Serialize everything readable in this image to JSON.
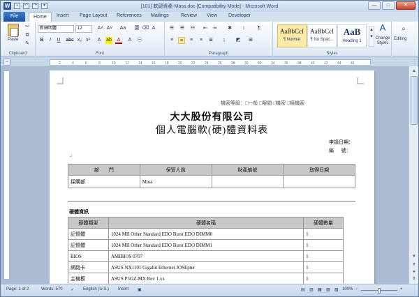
{
  "titlebar": {
    "title": "[101] 軟硬資產-Mass.doc [Compatibility Mode] - Microsoft Word",
    "logo": "W",
    "qat_icons": [
      "save-icon",
      "undo-icon",
      "redo-icon",
      "customize-icon"
    ],
    "controls": {
      "minimize": "—",
      "maximize": "□",
      "close": "✕"
    }
  },
  "tabs": {
    "file": "File",
    "items": [
      "Home",
      "Insert",
      "Page Layout",
      "References",
      "Mailings",
      "Review",
      "View",
      "Developer"
    ]
  },
  "ribbon": {
    "clipboard": {
      "label": "Clipboard",
      "paste": "Paste"
    },
    "font": {
      "label": "Font",
      "name": "新細明體",
      "size": "12",
      "bold": "B",
      "italic": "I",
      "underline": "U",
      "strike": "abc",
      "sub": "x₂",
      "sup": "x²",
      "grow": "A˄",
      "shrink": "A˅",
      "case": "Aa",
      "color": "A"
    },
    "paragraph": {
      "label": "Paragraph"
    },
    "styles": {
      "label": "Styles",
      "items": [
        {
          "sample": "AaBbCcI",
          "name": "¶ Normal"
        },
        {
          "sample": "AaBbCcI",
          "name": "¶ No Spac..."
        },
        {
          "sample": "AaB",
          "name": "Heading 1"
        }
      ],
      "change": "Change Styles"
    },
    "editing": {
      "label": "Editing"
    }
  },
  "ruler": {
    "ticks": [
      "2",
      "4",
      "6",
      "8",
      "10",
      "12",
      "14",
      "16",
      "18",
      "20",
      "22",
      "24",
      "26",
      "28",
      "30",
      "32",
      "34",
      "36",
      "38",
      "40",
      "42",
      "44",
      "46"
    ]
  },
  "document": {
    "classification": "機密等級：□一般  □限閱  □機密  □極機密",
    "company": "大大股份有限公司",
    "title": "個人電腦軟(硬)體資料表",
    "apply_date": "申請日期：",
    "number": "編      號：",
    "table1": {
      "headers": [
        "部　　門",
        "保管人員",
        "財產編號",
        "取得日期"
      ],
      "row": [
        "採購部",
        "Mass",
        "",
        ""
      ]
    },
    "section_hw": "硬體資訊",
    "table2": {
      "headers": [
        "硬體類型",
        "硬體名稱",
        "硬體數量"
      ],
      "rows": [
        [
          "記憶體",
          "1024 MB Other Standard EDO Burst EDO DIMM0",
          "1"
        ],
        [
          "記憶體",
          "1024 MB Other Standard EDO Burst EDO DIMM1",
          "1"
        ],
        [
          "BIOS",
          "AMIBIOS 0707",
          "1"
        ],
        [
          "網路卡",
          "ASUS NX1101 Gigabit Ethernet JOSEpter",
          "1"
        ],
        [
          "主機板",
          "ASUS P5GZ-MX Rev 1.xx",
          "1"
        ]
      ]
    }
  },
  "status": {
    "page": "Page: 1 of 2",
    "words": "Words: 570",
    "lang": "English (U.S.)",
    "mode": "Insert",
    "zoom": "100%"
  },
  "colors": {
    "accent": "#2b579a",
    "file_tab": "#2a64b8",
    "ribbon_bg": "#dfe9f5"
  }
}
